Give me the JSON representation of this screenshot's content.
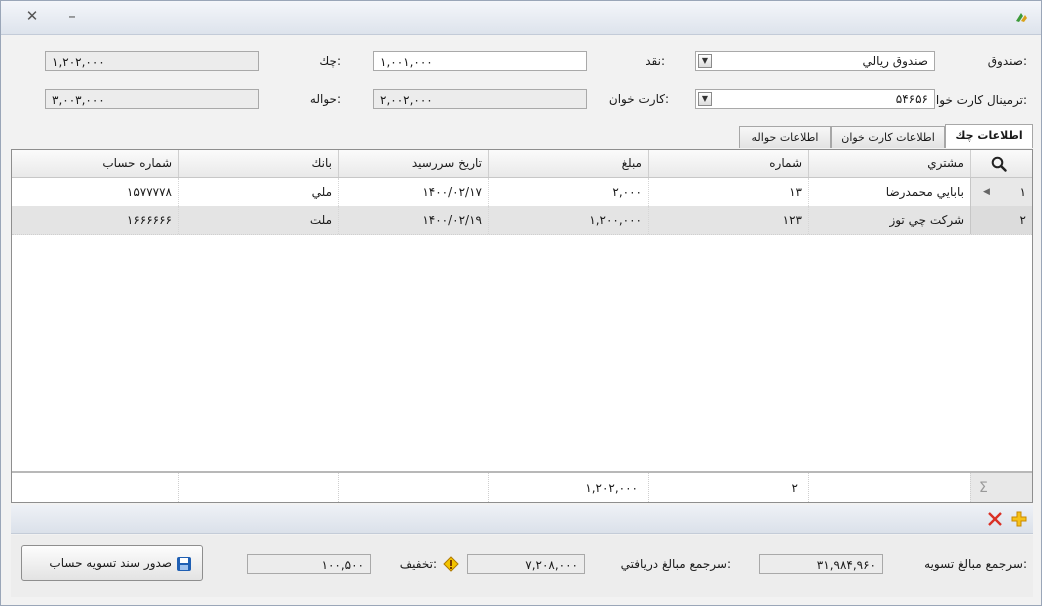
{
  "window": {
    "close_glyph": "✕",
    "minimize_glyph": "–"
  },
  "form": {
    "fund_label": "صندوق:",
    "fund_value": "صندوق ريالي",
    "cash_label": "نقد:",
    "cash_value": "۱,۰۰۱,۰۰۰",
    "check_label": "چك:",
    "check_value": "۱,۲۰۲,۰۰۰",
    "terminal_label": "ترمينال كارت خوان:",
    "terminal_value": "۵۴۶۵۶",
    "card_label": "كارت خوان:",
    "card_value": "۲,۰۰۲,۰۰۰",
    "transfer_label": "حواله:",
    "transfer_value": "۳,۰۰۳,۰۰۰"
  },
  "tabs": [
    {
      "label": "اطلاعات چك"
    },
    {
      "label": "اطلاعات كارت خوان"
    },
    {
      "label": "اطلاعات حواله"
    }
  ],
  "grid": {
    "headers": {
      "customer": "مشتري",
      "number": "شماره",
      "amount": "مبلغ",
      "due_date": "تاريخ سررسيد",
      "bank": "بانك",
      "account": "شماره حساب"
    },
    "rows": [
      {
        "index": "۱",
        "customer": "بابايي محمدرضا",
        "number": "۱۳",
        "amount": "۲,۰۰۰",
        "due_date": "۱۴۰۰/۰۲/۱۷",
        "bank": "ملي",
        "account": "۱۵۷۷۷۷۸"
      },
      {
        "index": "۲",
        "customer": "شركت چي توز",
        "number": "۱۲۳",
        "amount": "۱,۲۰۰,۰۰۰",
        "due_date": "۱۴۰۰/۰۲/۱۹",
        "bank": "ملت",
        "account": "۱۶۶۶۶۶۶"
      }
    ],
    "footer": {
      "sigma": "Σ",
      "count": "۲",
      "amount_total": "۱,۲۰۲,۰۰۰"
    }
  },
  "summary": {
    "settle_label": "سرجمع مبالغ تسويه:",
    "settle_value": "۳۱,۹۸۴,۹۶۰",
    "received_label": "سرجمع مبالغ دريافتي:",
    "received_value": "۷,۲۰۸,۰۰۰",
    "discount_label": "تخفيف:",
    "discount_value": "۱۰۰,۵۰۰",
    "issue_button": "صدور سند تسويه حساب"
  },
  "colors": {
    "accent": "#1f5fb3",
    "delete": "#d93025",
    "add": "#f0a400",
    "warning": "#f3c400"
  },
  "icons": {
    "search": "search-icon",
    "delete": "delete-icon",
    "add": "add-icon",
    "warning": "warning-icon",
    "save": "save-icon",
    "logo": "app-logo-icon"
  }
}
